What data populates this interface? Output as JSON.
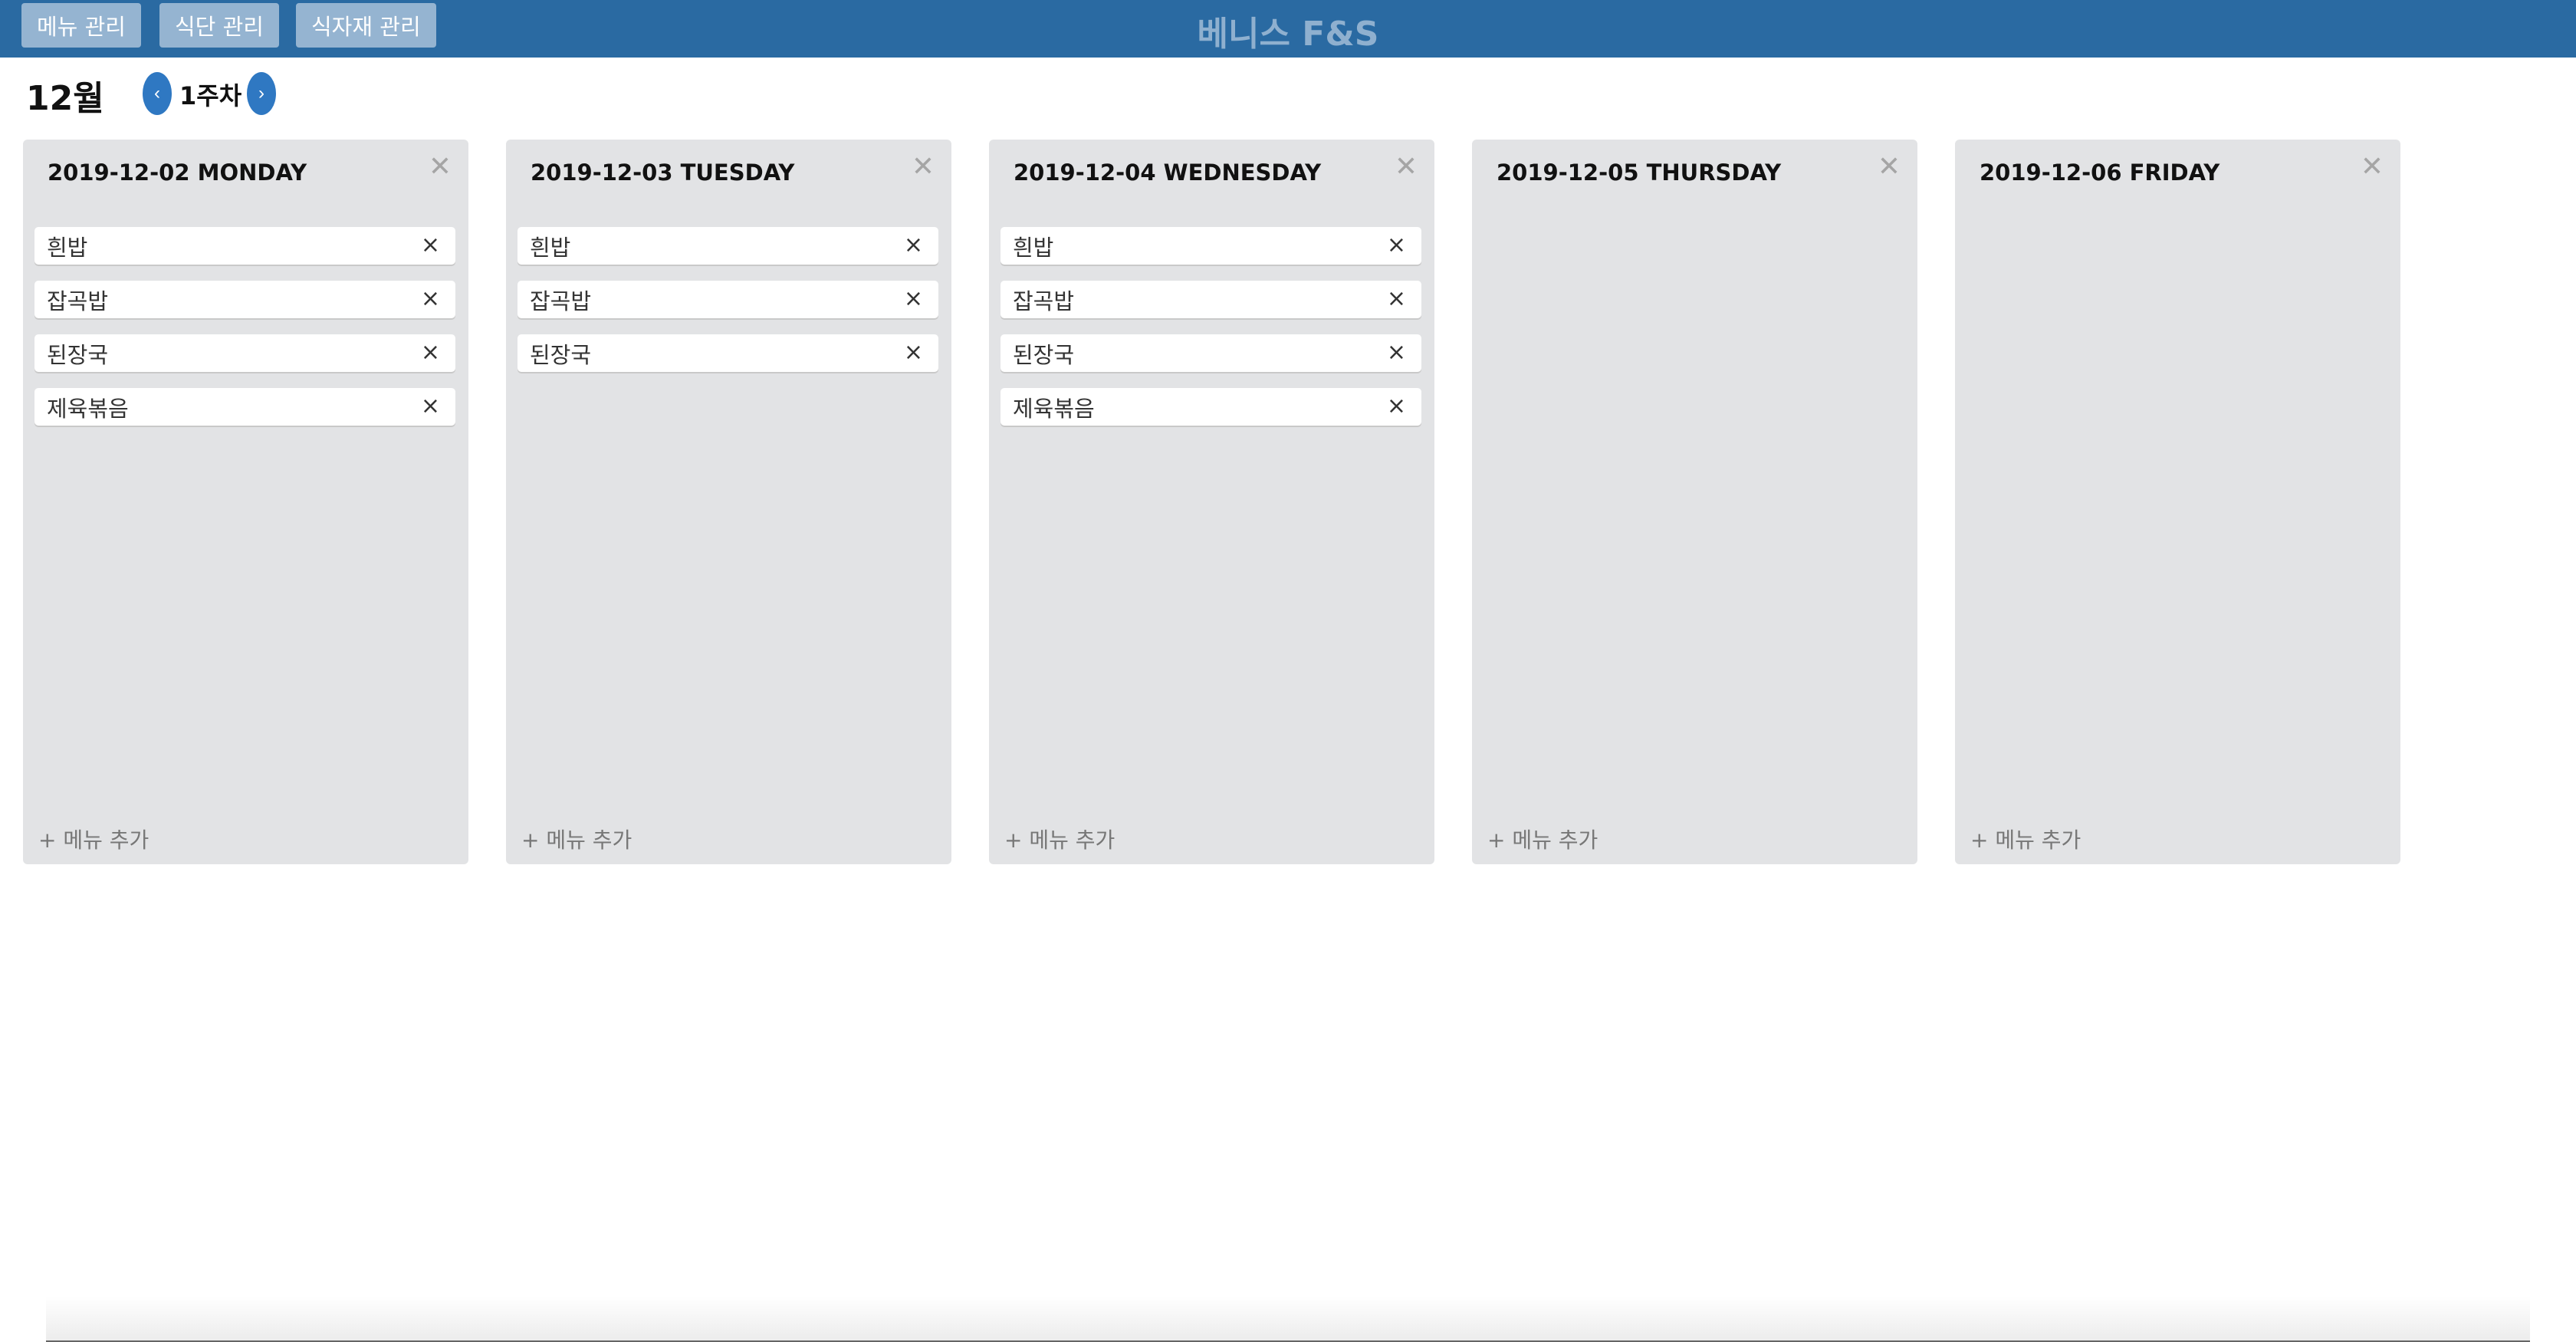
{
  "header": {
    "nav": [
      "메뉴 관리",
      "식단 관리",
      "식자재 관리"
    ],
    "brand": "베니스 F&S",
    "color": "#2a6aa2"
  },
  "calendar": {
    "month": "12월",
    "week": "1주차",
    "prev_icon": "chevron-left-icon",
    "next_icon": "chevron-right-icon",
    "prev": "‹",
    "next": "›"
  },
  "close_glyph": "✕",
  "item_close_glyph": "×",
  "add_label": "+ 메뉴 추가",
  "days": [
    {
      "title": "2019-12-02 MONDAY",
      "items": [
        "흰밥",
        "잡곡밥",
        "된장국",
        "제육볶음"
      ]
    },
    {
      "title": "2019-12-03 TUESDAY",
      "items": [
        "흰밥",
        "잡곡밥",
        "된장국"
      ]
    },
    {
      "title": "2019-12-04 WEDNESDAY",
      "items": [
        "흰밥",
        "잡곡밥",
        "된장국",
        "제육볶음"
      ]
    },
    {
      "title": "2019-12-05 THURSDAY",
      "items": []
    },
    {
      "title": "2019-12-06 FRIDAY",
      "items": []
    }
  ]
}
